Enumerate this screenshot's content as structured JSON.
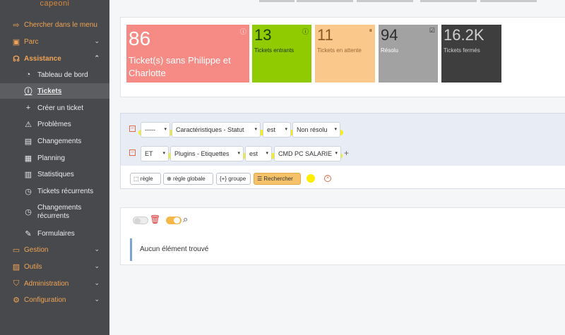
{
  "logo": "capeoni",
  "sidebar": {
    "search": "Chercher dans le menu",
    "parc": "Parc",
    "assistance": "Assistance",
    "items": {
      "dashboard": "Tableau de bord",
      "tickets": "Tickets",
      "create": "Créer un ticket",
      "problems": "Problèmes",
      "changes": "Changements",
      "planning": "Planning",
      "stats": "Statistiques",
      "recurrent_tickets": "Tickets récurrents",
      "recurrent_changes_1": "Changements",
      "recurrent_changes_2": "récurrents",
      "forms": "Formulaires"
    },
    "gestion": "Gestion",
    "outils": "Outils",
    "administration": "Administration",
    "configuration": "Configuration"
  },
  "stats": {
    "t1": {
      "num": "86",
      "label": "Ticket(s) sans Philippe et Charlotte"
    },
    "t2": {
      "num": "13",
      "label": "Tickets entrants"
    },
    "t3": {
      "num": "11",
      "label": "Tickets en attente"
    },
    "t4": {
      "num": "94",
      "label": "Résolu"
    },
    "t5": {
      "num": "16.2K",
      "label": "Tickets fermés"
    }
  },
  "filters": {
    "row1": {
      "link": "-----",
      "field": "Caractéristiques - Statut",
      "op": "est",
      "value": "Non résolu"
    },
    "row2": {
      "link": "ET",
      "field": "Plugins - Etiquettes",
      "op": "est",
      "value": "CMD PC SALARIE"
    },
    "add_symbol": "+",
    "buttons": {
      "rule": "règle",
      "global_rule": "règle globale",
      "group": "groupe",
      "search": "Rechercher"
    }
  },
  "results": {
    "empty": "Aucun élément trouvé"
  },
  "colors": {
    "accent": "#f0a356",
    "sidebar_bg": "#47494c",
    "highlight": "#f5f000"
  }
}
